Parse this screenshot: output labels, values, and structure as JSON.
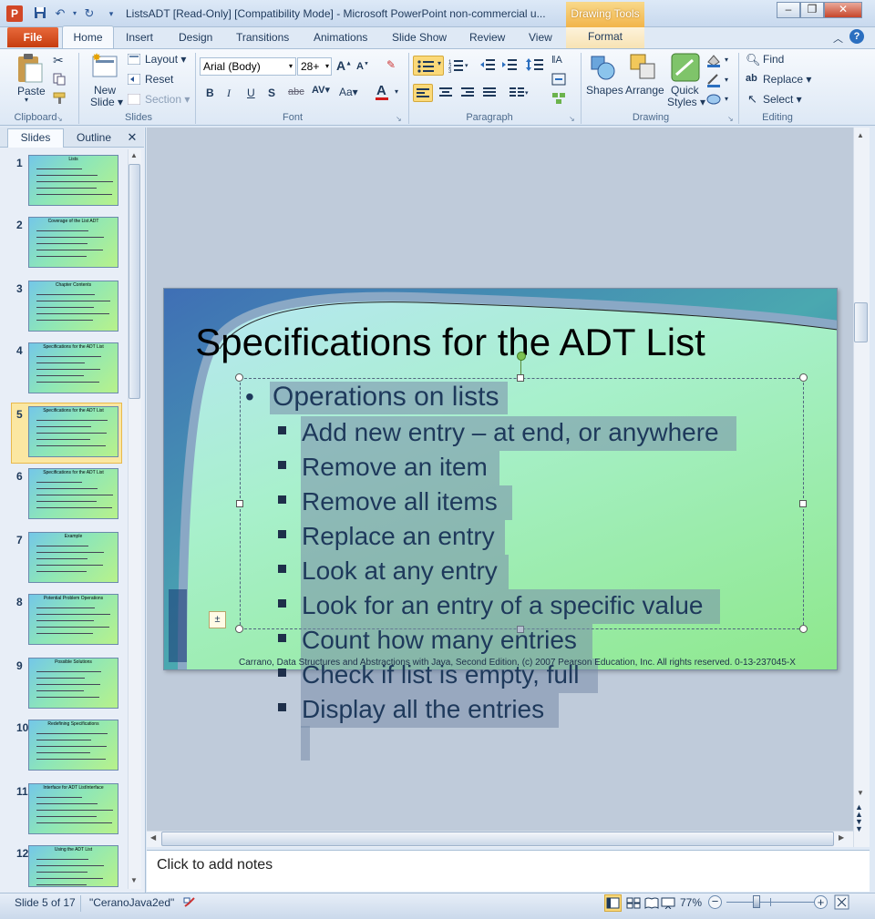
{
  "window": {
    "title": "ListsADT [Read-Only] [Compatibility Mode]  -  Microsoft PowerPoint non-commercial u...",
    "contextual_tab": "Drawing Tools"
  },
  "tabs": {
    "file": "File",
    "items": [
      "Home",
      "Insert",
      "Design",
      "Transitions",
      "Animations",
      "Slide Show",
      "Review",
      "View"
    ],
    "format": "Format"
  },
  "ribbon": {
    "clipboard": {
      "paste": "Paste",
      "label": "Clipboard"
    },
    "slides": {
      "new_slide_line1": "New",
      "new_slide_line2": "Slide ▾",
      "layout": "Layout ▾",
      "reset": "Reset",
      "section": "Section ▾",
      "label": "Slides"
    },
    "font": {
      "font_name": "Arial (Body)",
      "font_size": "28+",
      "label": "Font"
    },
    "paragraph": {
      "label": "Paragraph"
    },
    "drawing": {
      "shapes": "Shapes",
      "arrange": "Arrange",
      "quick_styles_line1": "Quick",
      "quick_styles_line2": "Styles ▾",
      "label": "Drawing"
    },
    "editing": {
      "find": "Find",
      "replace": "Replace ▾",
      "select": "Select ▾",
      "label": "Editing"
    }
  },
  "pane": {
    "tab_slides": "Slides",
    "tab_outline": "Outline",
    "close": "✕"
  },
  "thumbnails": [
    {
      "num": "1",
      "title": "Lists"
    },
    {
      "num": "2",
      "title": "Coverage  of  the List ADT"
    },
    {
      "num": "3",
      "title": "Chapter Contents"
    },
    {
      "num": "4",
      "title": "Specifications  for the ADT List"
    },
    {
      "num": "5",
      "title": "Specifications  for the ADT List"
    },
    {
      "num": "6",
      "title": "Specifications  for the ADT List"
    },
    {
      "num": "7",
      "title": "Example"
    },
    {
      "num": "8",
      "title": "Potential  Problem  Operations"
    },
    {
      "num": "9",
      "title": "Possible  Solutions"
    },
    {
      "num": "10",
      "title": "Redefining  Specifications"
    },
    {
      "num": "11",
      "title": "Interface  for ADT  ListInterface"
    },
    {
      "num": "12",
      "title": "Using  the ADT List"
    }
  ],
  "slide": {
    "title": "Specifications for the ADT List",
    "bullet_main": "Operations  on lists",
    "sub_bullets": [
      "Add new entry – at end, or anywhere",
      "Remove an item",
      "Remove all items",
      "Replace an entry",
      "Look at any entry",
      "Look for an entry of a specific value",
      "Count how many entries",
      "Check if list is empty, full",
      "Display all the entries"
    ],
    "footer": "Carrano, Data Structures and Abstractions with Java, Second Edition, (c) 2007 Pearson Education, Inc. All rights reserved. 0-13-237045-X"
  },
  "notes": {
    "placeholder": "Click to add notes"
  },
  "status": {
    "slide_info": "Slide 5 of 17",
    "theme": "\"CeranoJava2ed\"",
    "zoom": "77%"
  },
  "colors": {
    "accent": "#2b5797",
    "file_tab": "#c63d0f",
    "selection": "#fbe7a2"
  }
}
